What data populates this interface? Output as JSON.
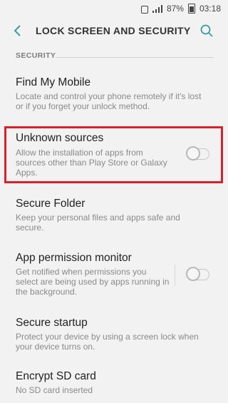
{
  "status_bar": {
    "battery": "87%",
    "time": "03:18"
  },
  "toolbar": {
    "title": "LOCK SCREEN AND SECURITY",
    "back_icon": "back-arrow-icon",
    "search_icon": "search-icon"
  },
  "section": {
    "header": "SECURITY"
  },
  "settings": [
    {
      "title": "Find My Mobile",
      "summary_lines": [
        "Locate and control your phone remotely if it's lost",
        "or if you forget your unlock method."
      ]
    },
    {
      "title": "Unknown sources",
      "summary_lines": [
        "Allow the installation of apps from",
        "sources other than Play Store or Galaxy",
        "Apps."
      ],
      "toggle": "off"
    },
    {
      "title": "Secure Folder",
      "summary_lines": [
        "Keep your personal files and apps safe and",
        "secure."
      ]
    },
    {
      "title": "App permission monitor",
      "summary_lines": [
        "Get notified when permissions you",
        "select are being used by apps running in",
        "the background."
      ],
      "toggle": "off"
    },
    {
      "title": "Secure startup",
      "summary_lines": [
        "Protect your device by using a screen lock when",
        "your device turns on."
      ]
    },
    {
      "title": "Encrypt SD card",
      "summary_lines": [
        "No SD card inserted"
      ]
    }
  ],
  "colors": {
    "background": "#f2f2f2",
    "accent": "#3a9aa6",
    "highlight": "#d9202a"
  }
}
